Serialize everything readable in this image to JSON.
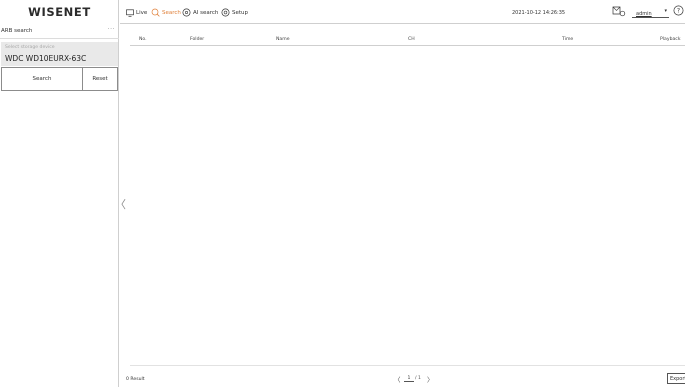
{
  "app": {
    "logo": "WISENET"
  },
  "topbar": {
    "nav": [
      {
        "label": "Live",
        "icon": "monitor-icon",
        "active": false
      },
      {
        "label": "Search",
        "icon": "search-icon",
        "active": true
      },
      {
        "label": "AI search",
        "icon": "ai-search-icon",
        "active": false
      },
      {
        "label": "Setup",
        "icon": "gear-icon",
        "active": false
      }
    ],
    "datetime": "2021-10-12 14:26:35",
    "user": "admin",
    "accent_color": "#e0803a"
  },
  "sidebar": {
    "title": "ARB search",
    "more": "···",
    "storage_placeholder": "Select storage device",
    "storage_value": "WDC WD10EURX-63C",
    "search_label": "Search",
    "reset_label": "Reset",
    "collapse_glyph": "〈"
  },
  "table": {
    "columns": [
      "No.",
      "Folder",
      "Name",
      "CH",
      "Time",
      "Playback"
    ],
    "rows": []
  },
  "footer": {
    "result": "0 Result",
    "page_current": "1",
    "page_total_text": "/ 1",
    "prev": "〈",
    "next": "〉",
    "export_label": "Export"
  }
}
